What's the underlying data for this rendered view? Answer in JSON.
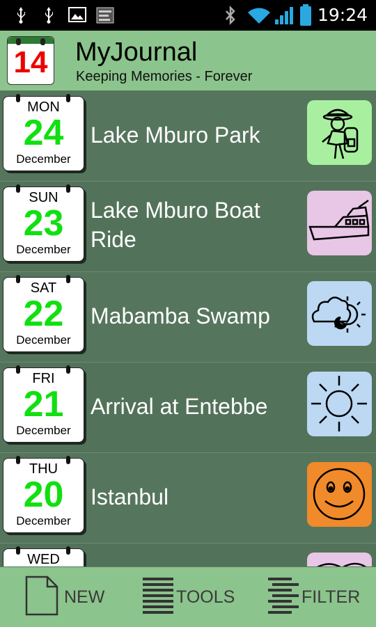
{
  "status_bar": {
    "time": "19:24",
    "icons": [
      "usb-icon",
      "usb-icon",
      "image-icon",
      "app-notification-icon",
      "bluetooth-icon",
      "wifi-icon",
      "signal-icon",
      "battery-icon"
    ]
  },
  "header": {
    "app_icon_number": "14",
    "title": "MyJournal",
    "subtitle": "Keeping Memories - Forever"
  },
  "entries": [
    {
      "dow": "MON",
      "day": "24",
      "month": "December",
      "title": "Lake Mburo Park",
      "thumb_icon": "hiker-icon",
      "thumb_color": "#a8f0a0"
    },
    {
      "dow": "SUN",
      "day": "23",
      "month": "December",
      "title": "Lake Mburo Boat Ride",
      "thumb_icon": "boat-icon",
      "thumb_color": "#e8c6e6"
    },
    {
      "dow": "SAT",
      "day": "22",
      "month": "December",
      "title": "Mabamba Swamp",
      "thumb_icon": "weather-icon",
      "thumb_color": "#bcd8f2"
    },
    {
      "dow": "FRI",
      "day": "21",
      "month": "December",
      "title": "Arrival at Entebbe",
      "thumb_icon": "sun-icon",
      "thumb_color": "#bcd8f2"
    },
    {
      "dow": "THU",
      "day": "20",
      "month": "December",
      "title": "Istanbul",
      "thumb_icon": "smiley-icon",
      "thumb_color": "#f08a2a"
    },
    {
      "dow": "WED",
      "day": "",
      "month": "",
      "title": "",
      "thumb_icon": "partial-icon",
      "thumb_color": "#e8c6e6"
    }
  ],
  "bottom_bar": {
    "new_label": "NEW",
    "tools_label": "TOOLS",
    "filter_label": "FILTER"
  },
  "colors": {
    "header_bg": "#8bc48c",
    "list_bg": "#53725a",
    "day_number": "#10e010"
  }
}
